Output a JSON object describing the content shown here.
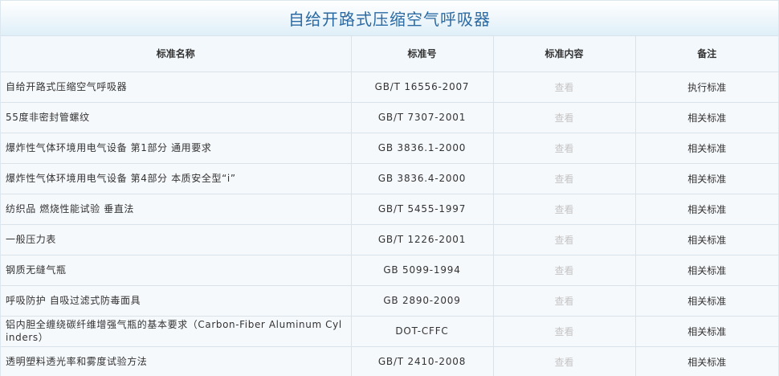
{
  "page_title": "自给开路式压缩空气呼吸器",
  "table": {
    "headers": {
      "name": "标准名称",
      "code": "标准号",
      "content": "标准内容",
      "note": "备注"
    },
    "rows": [
      {
        "name": "自给开路式压缩空气呼吸器",
        "code": "GB/T 16556-2007",
        "view": "查看",
        "note": "执行标准"
      },
      {
        "name": "55度非密封管螺纹",
        "code": "GB/T 7307-2001",
        "view": "查看",
        "note": "相关标准"
      },
      {
        "name": "爆炸性气体环境用电气设备 第1部分 通用要求",
        "code": "GB 3836.1-2000",
        "view": "查看",
        "note": "相关标准"
      },
      {
        "name": "爆炸性气体环境用电气设备 第4部分 本质安全型“i”",
        "code": "GB 3836.4-2000",
        "view": "查看",
        "note": "相关标准"
      },
      {
        "name": "纺织品 燃烧性能试验 垂直法",
        "code": "GB/T 5455-1997",
        "view": "查看",
        "note": "相关标准"
      },
      {
        "name": "一般压力表",
        "code": "GB/T 1226-2001",
        "view": "查看",
        "note": "相关标准"
      },
      {
        "name": "钢质无缝气瓶",
        "code": "GB 5099-1994",
        "view": "查看",
        "note": "相关标准"
      },
      {
        "name": "呼吸防护 自吸过滤式防毒面具",
        "code": "GB 2890-2009",
        "view": "查看",
        "note": "相关标准"
      },
      {
        "name": "铝内胆全缠绕碳纤维增强气瓶的基本要求（Carbon-Fiber Aluminum Cylinders）",
        "code": "DOT-CFFC",
        "view": "查看",
        "note": "相关标准"
      },
      {
        "name": "透明塑料透光率和雾度试验方法",
        "code": "GB/T 2410-2008",
        "view": "查看",
        "note": "相关标准"
      }
    ]
  }
}
